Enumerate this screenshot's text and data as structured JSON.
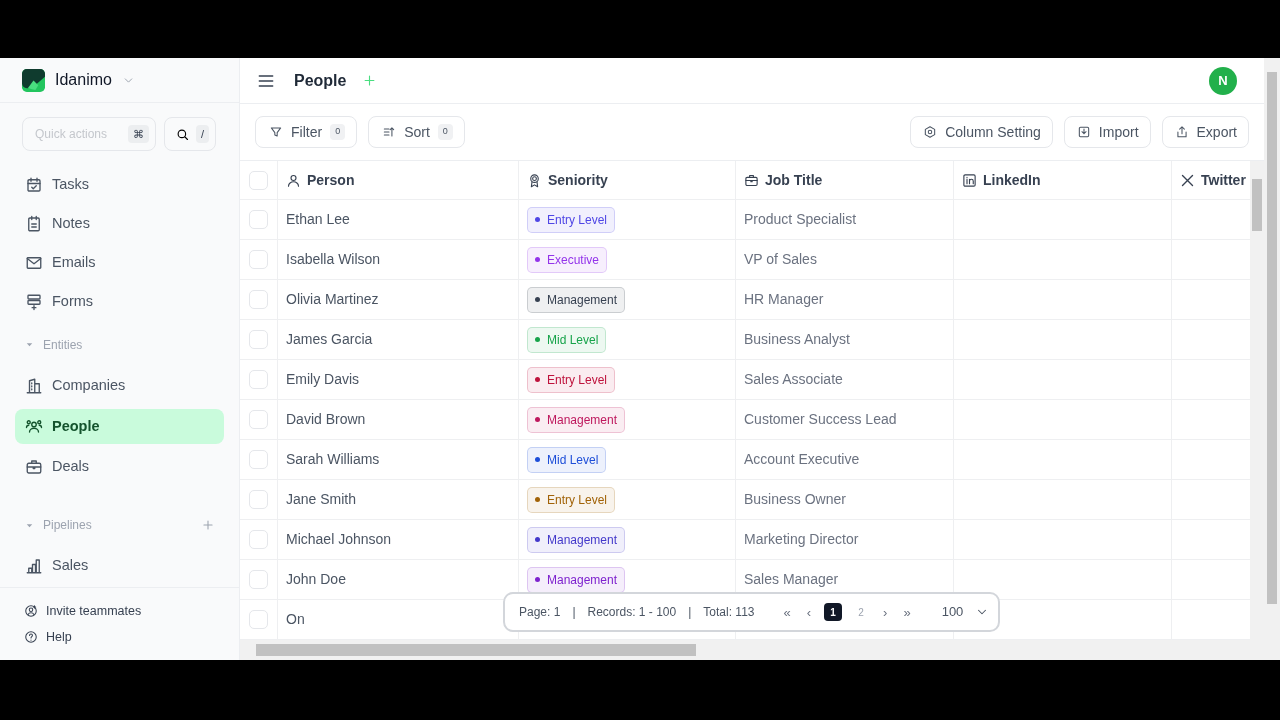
{
  "workspace": {
    "name": "Idanimo"
  },
  "sidebar": {
    "quick_actions": {
      "placeholder": "Quick actions",
      "shortcut": "⌘"
    },
    "search_shortcut": "/",
    "items": [
      {
        "label": "Tasks",
        "selected": false
      },
      {
        "label": "Notes",
        "selected": false
      },
      {
        "label": "Emails",
        "selected": false
      },
      {
        "label": "Forms",
        "selected": false
      }
    ],
    "sections": [
      {
        "title": "Entities",
        "items": [
          {
            "label": "Companies",
            "selected": false
          },
          {
            "label": "People",
            "selected": true
          },
          {
            "label": "Deals",
            "selected": false
          }
        ]
      },
      {
        "title": "Pipelines",
        "add": true,
        "items": [
          {
            "label": "Sales",
            "selected": false
          }
        ]
      }
    ],
    "footer": [
      {
        "label": "Invite teammates"
      },
      {
        "label": "Help"
      }
    ]
  },
  "header": {
    "title": "People",
    "avatar": "N"
  },
  "toolbar": {
    "left": [
      {
        "label": "Filter",
        "count": "0"
      },
      {
        "label": "Sort",
        "count": "0"
      }
    ],
    "right": [
      {
        "label": "Column Setting"
      },
      {
        "label": "Import"
      },
      {
        "label": "Export"
      }
    ]
  },
  "table": {
    "all_checked": false,
    "columns": [
      "Person",
      "Seniority",
      "Job Title",
      "LinkedIn",
      "Twitter"
    ],
    "rows": [
      {
        "checked": false,
        "person": "Ethan Lee",
        "seniority": "Entry Level",
        "color": "#4f46e5",
        "job_title": "Product Specialist"
      },
      {
        "checked": false,
        "person": "Isabella Wilson",
        "seniority": "Executive",
        "color": "#9333ea",
        "job_title": "VP of Sales"
      },
      {
        "checked": false,
        "person": "Olivia Martinez",
        "seniority": "Management",
        "color": "#374151",
        "job_title": "HR Manager"
      },
      {
        "checked": false,
        "person": "James Garcia",
        "seniority": "Mid Level",
        "color": "#16a34a",
        "job_title": "Business Analyst"
      },
      {
        "checked": false,
        "person": "Emily Davis",
        "seniority": "Entry Level",
        "color": "#be123c",
        "job_title": "Sales Associate"
      },
      {
        "checked": false,
        "person": "David Brown",
        "seniority": "Management",
        "color": "#be185d",
        "job_title": "Customer Success Lead"
      },
      {
        "checked": false,
        "person": "Sarah Williams",
        "seniority": "Mid Level",
        "color": "#1d4ed8",
        "job_title": "Account Executive"
      },
      {
        "checked": false,
        "person": "Jane Smith",
        "seniority": "Entry Level",
        "color": "#a16207",
        "job_title": "Business Owner"
      },
      {
        "checked": false,
        "person": "Michael Johnson",
        "seniority": "Management",
        "color": "#4338ca",
        "job_title": "Marketing Director"
      },
      {
        "checked": false,
        "person": "John Doe",
        "seniority": "Management",
        "color": "#7e22ce",
        "job_title": "Sales Manager"
      },
      {
        "checked": false,
        "person": "On"
      }
    ]
  },
  "pagination": {
    "page": "Page: 1",
    "separators": [
      "|",
      "|"
    ],
    "records": "Records: 1 - 100",
    "total": "Total: 113",
    "first": "«",
    "prev": "‹",
    "pages": [
      {
        "label": "1",
        "selected": true
      },
      {
        "label": "2",
        "selected": false
      }
    ],
    "next": "›",
    "last": "»",
    "page_size": "100"
  }
}
